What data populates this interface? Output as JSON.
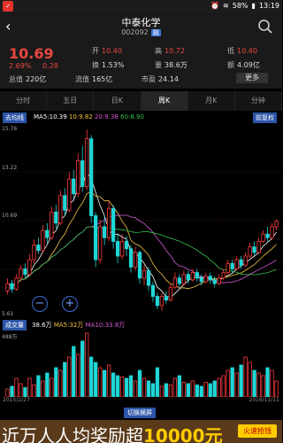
{
  "status": {
    "battery": "58%",
    "time": "13:19"
  },
  "header": {
    "title": "中泰化学",
    "code": "002092",
    "tag": "融"
  },
  "quote": {
    "price": "10.69",
    "change_pct": "2.69%",
    "change": "0.28",
    "open_label": "开",
    "open": "10.40",
    "high_label": "高",
    "high": "10.72",
    "low_label": "低",
    "low": "10.40",
    "turnover_label": "换",
    "turnover": "1.53%",
    "volume_label": "量",
    "volume": "38.6万",
    "amount_label": "额",
    "amount": "4.09亿",
    "mktcap_label": "总值",
    "mktcap": "220亿",
    "float_label": "流值",
    "float": "165亿",
    "pe_label": "市盈",
    "pe": "24.14",
    "more_label": "更多"
  },
  "tabs": [
    "分时",
    "五日",
    "日K",
    "周K",
    "月K",
    "分钟"
  ],
  "chart": {
    "mode_label": "去均线",
    "ma5": "MA5:10.39",
    "ma10": "10:9.82",
    "ma20": "20:9.38",
    "ma60": "60:8.90",
    "adjust_label": "前复权",
    "ytop": "15.76",
    "ymid1": "13.22",
    "ymid2": "10.69",
    "ybottom": "5.61"
  },
  "vol": {
    "mode_label": "成交量",
    "vol": "38.6万",
    "ma5": "MA5:32万",
    "ma10": "MA10:33.8万",
    "ytop": "488万"
  },
  "dates": {
    "start": "2015/2/27",
    "end": "2016/11/11"
  },
  "switch_label": "切换横屏",
  "banner": {
    "text_pre": "近万人人均奖励超",
    "text_amount": "10000元",
    "button": "火速抢钱"
  },
  "chart_data": {
    "type": "candlestick",
    "ylim": [
      5.61,
      15.76
    ],
    "candles": [
      [
        6.9,
        7.3,
        7.6,
        6.7
      ],
      [
        7.3,
        7.0,
        7.5,
        6.8
      ],
      [
        7.0,
        7.6,
        7.8,
        6.9
      ],
      [
        7.6,
        8.1,
        8.3,
        7.4
      ],
      [
        8.1,
        7.8,
        8.4,
        7.6
      ],
      [
        7.8,
        8.6,
        8.9,
        7.7
      ],
      [
        8.6,
        9.4,
        9.7,
        8.4
      ],
      [
        9.4,
        9.1,
        9.8,
        8.9
      ],
      [
        9.1,
        10.2,
        10.5,
        9.0
      ],
      [
        10.2,
        9.8,
        10.6,
        9.5
      ],
      [
        9.8,
        11.2,
        11.5,
        9.7
      ],
      [
        11.2,
        10.6,
        11.6,
        10.3
      ],
      [
        10.6,
        12.1,
        12.4,
        10.5
      ],
      [
        12.1,
        11.3,
        12.5,
        11.0
      ],
      [
        11.3,
        13.0,
        13.4,
        11.2
      ],
      [
        13.0,
        12.2,
        13.5,
        11.9
      ],
      [
        12.2,
        14.0,
        14.4,
        12.0
      ],
      [
        14.0,
        12.6,
        14.8,
        12.3
      ],
      [
        12.6,
        15.2,
        15.7,
        12.4
      ],
      [
        15.2,
        11.0,
        15.4,
        10.6
      ],
      [
        11.0,
        8.6,
        11.2,
        8.2
      ],
      [
        8.6,
        10.4,
        10.8,
        8.4
      ],
      [
        10.4,
        9.8,
        11.0,
        9.4
      ],
      [
        9.8,
        11.4,
        11.8,
        9.6
      ],
      [
        11.4,
        9.6,
        11.6,
        9.2
      ],
      [
        9.6,
        8.8,
        10.0,
        8.4
      ],
      [
        8.8,
        9.6,
        10.0,
        8.6
      ],
      [
        9.6,
        9.2,
        9.9,
        8.8
      ],
      [
        9.2,
        8.2,
        9.4,
        7.9
      ],
      [
        8.2,
        9.0,
        9.3,
        8.0
      ],
      [
        9.0,
        7.6,
        9.1,
        7.3
      ],
      [
        7.6,
        8.0,
        8.3,
        7.2
      ],
      [
        8.0,
        7.2,
        8.2,
        6.9
      ],
      [
        7.2,
        6.6,
        7.4,
        6.3
      ],
      [
        6.6,
        6.1,
        6.8,
        5.9
      ],
      [
        6.1,
        6.6,
        6.8,
        5.8
      ],
      [
        6.6,
        6.4,
        6.9,
        6.2
      ],
      [
        6.4,
        7.1,
        7.3,
        6.3
      ],
      [
        7.1,
        7.6,
        7.9,
        7.0
      ],
      [
        7.6,
        7.3,
        7.8,
        7.1
      ],
      [
        7.3,
        7.8,
        8.0,
        7.2
      ],
      [
        7.8,
        7.5,
        8.0,
        7.3
      ],
      [
        7.5,
        7.9,
        8.1,
        7.4
      ],
      [
        7.9,
        7.6,
        8.1,
        7.4
      ],
      [
        7.6,
        7.4,
        7.8,
        7.2
      ],
      [
        7.4,
        7.7,
        7.9,
        7.3
      ],
      [
        7.7,
        7.5,
        7.9,
        7.3
      ],
      [
        7.5,
        7.3,
        7.7,
        7.1
      ],
      [
        7.3,
        7.6,
        7.8,
        7.2
      ],
      [
        7.6,
        7.9,
        8.1,
        7.5
      ],
      [
        7.9,
        8.4,
        8.6,
        7.8
      ],
      [
        8.4,
        8.1,
        8.6,
        7.9
      ],
      [
        8.1,
        8.6,
        8.8,
        8.0
      ],
      [
        8.6,
        8.3,
        8.8,
        8.1
      ],
      [
        8.3,
        8.8,
        9.0,
        8.2
      ],
      [
        8.8,
        9.3,
        9.5,
        8.7
      ],
      [
        9.3,
        9.0,
        9.6,
        8.8
      ],
      [
        9.0,
        9.6,
        9.8,
        8.9
      ],
      [
        9.6,
        10.0,
        10.2,
        9.5
      ],
      [
        10.0,
        9.8,
        10.4,
        9.6
      ],
      [
        9.8,
        10.4,
        10.6,
        9.7
      ],
      [
        10.4,
        10.69,
        10.8,
        10.2
      ]
    ],
    "volumes": [
      60,
      80,
      140,
      100,
      70,
      140,
      90,
      160,
      120,
      180,
      140,
      220,
      200,
      260,
      300,
      380,
      320,
      420,
      480,
      300,
      260,
      220,
      200,
      240,
      180,
      160,
      150,
      140,
      160,
      120,
      200,
      140,
      120,
      100,
      220,
      80,
      100,
      90,
      140,
      160,
      110,
      100,
      120,
      90,
      80,
      110,
      100,
      120,
      140,
      160,
      200,
      220,
      180,
      240,
      300,
      260,
      200,
      180,
      160,
      220,
      200,
      120
    ]
  }
}
